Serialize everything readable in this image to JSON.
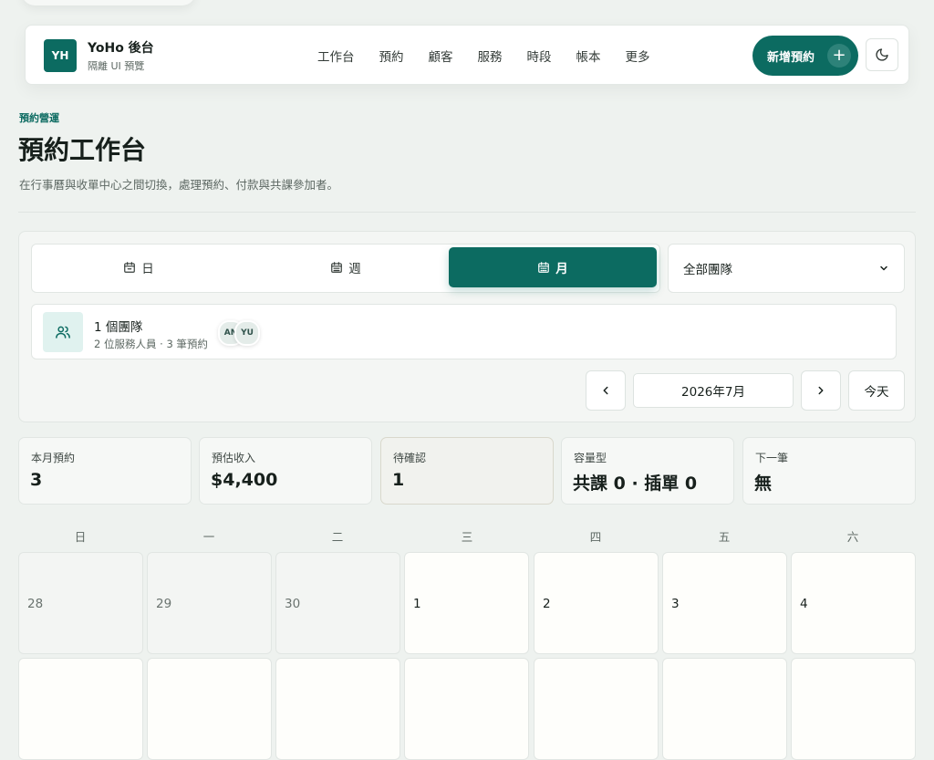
{
  "header": {
    "logo": "YH",
    "brand_title": "YoHo 後台",
    "brand_sub": "隔離 UI 預覽",
    "nav": [
      "工作台",
      "預約",
      "顧客",
      "服務",
      "時段",
      "帳本",
      "更多"
    ],
    "new_button": "新增預約",
    "new_button_icon": "plus-icon",
    "theme_toggle_icon": "moon-icon"
  },
  "page": {
    "eyebrow": "預約營運",
    "title": "預約工作台",
    "description": "在行事曆與收單中心之間切換，處理預約、付款與共課參加者。"
  },
  "view_switch": {
    "options": [
      {
        "label": "日",
        "icon": "calendar-day-icon"
      },
      {
        "label": "週",
        "icon": "calendar-week-icon"
      },
      {
        "label": "月",
        "icon": "calendar-month-icon"
      }
    ],
    "selected": "月"
  },
  "team_filter": {
    "selected": "全部團隊"
  },
  "team_summary": {
    "title": "1 個團隊",
    "subtitle": "2 位服務人員 · 3 筆預約",
    "avatars": [
      "AN",
      "YU"
    ]
  },
  "month_nav": {
    "current": "2026年7月",
    "today": "今天"
  },
  "stats": [
    {
      "label": "本月預約",
      "value": "3"
    },
    {
      "label": "預估收入",
      "value": "$4,400"
    },
    {
      "label": "待確認",
      "value": "1"
    },
    {
      "label": "容量型",
      "value": "共課 0 · 插單 0"
    },
    {
      "label": "下一筆",
      "value": "無"
    }
  ],
  "calendar": {
    "weekdays": [
      "日",
      "一",
      "二",
      "三",
      "四",
      "五",
      "六"
    ],
    "week1": [
      {
        "day": "28",
        "current": false
      },
      {
        "day": "29",
        "current": false
      },
      {
        "day": "30",
        "current": false
      },
      {
        "day": "1",
        "current": true
      },
      {
        "day": "2",
        "current": true
      },
      {
        "day": "3",
        "current": true
      },
      {
        "day": "4",
        "current": true
      }
    ]
  },
  "colors": {
    "accent": "#0c6b61",
    "background": "#eef2ef"
  }
}
